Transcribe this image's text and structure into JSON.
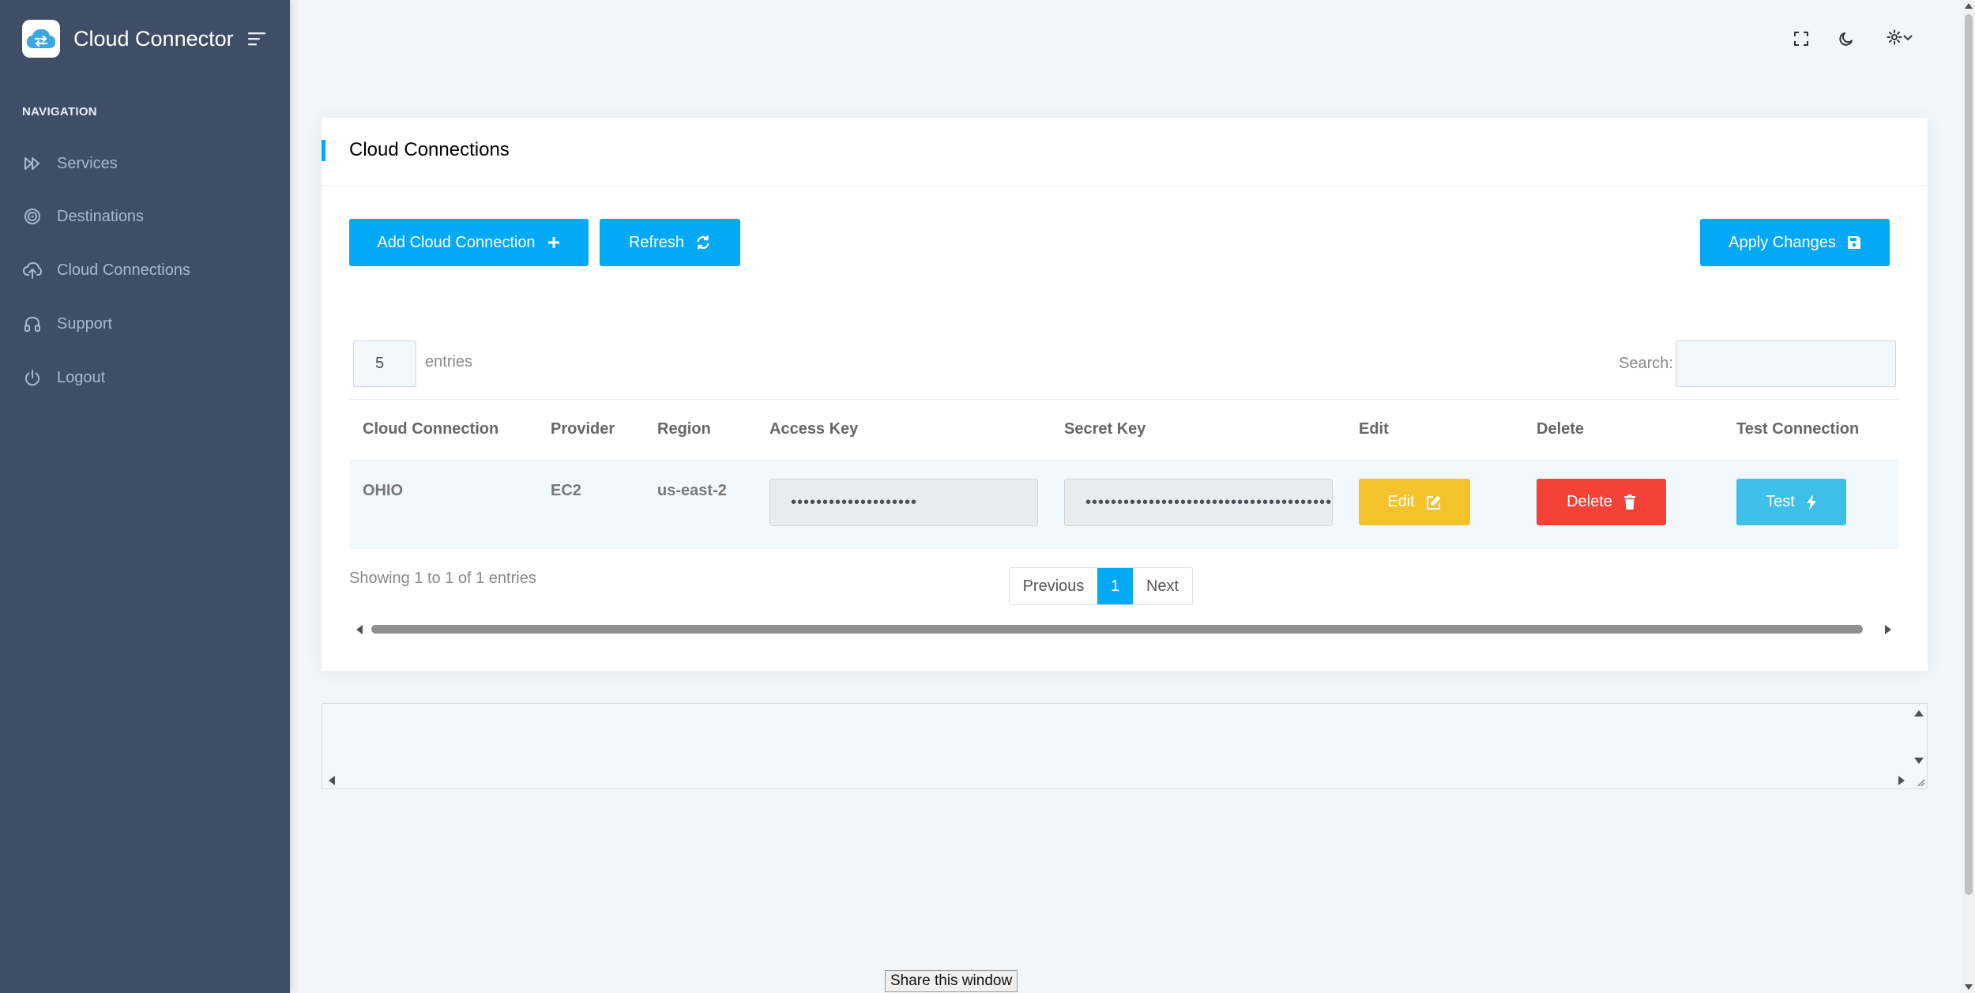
{
  "app": {
    "title": "Cloud Connector"
  },
  "sidebar": {
    "caption": "NAVIGATION",
    "items": [
      {
        "label": "Services",
        "icon": "fast-forward-icon"
      },
      {
        "label": "Destinations",
        "icon": "target-icon"
      },
      {
        "label": "Cloud Connections",
        "icon": "cloud-upload-icon"
      },
      {
        "label": "Support",
        "icon": "headphones-icon"
      },
      {
        "label": "Logout",
        "icon": "power-icon"
      }
    ]
  },
  "topbar": {
    "icons": [
      "fullscreen-icon",
      "moon-icon",
      "gear-icon",
      "chevron-down-icon"
    ]
  },
  "card": {
    "title": "Cloud Connections",
    "add_button": "Add Cloud Connection",
    "refresh_button": "Refresh",
    "apply_button": "Apply Changes"
  },
  "table": {
    "length_value": "5",
    "length_label": "entries",
    "search_label": "Search:",
    "search_value": "",
    "columns": [
      "Cloud Connection",
      "Provider",
      "Region",
      "Access Key",
      "Secret Key",
      "Edit",
      "Delete",
      "Test Connection"
    ],
    "rows": [
      {
        "cloud_connection": "OHIO",
        "provider": "EC2",
        "region": "us-east-2",
        "access_key": "••••••••••••••••••••",
        "secret_key": "••••••••••••••••••••••••••••••••••••••••",
        "edit_label": "Edit",
        "delete_label": "Delete",
        "test_label": "Test"
      }
    ],
    "info": "Showing 1 to 1 of 1 entries",
    "pager": {
      "previous": "Previous",
      "current": "1",
      "next": "Next"
    }
  },
  "tooltip": {
    "text": "Share this window"
  },
  "colors": {
    "sidebar": "#3f4d67",
    "primary": "#04a9f5",
    "warning": "#f4c22b",
    "danger": "#f44236",
    "info": "#3ebfea",
    "background": "#f2f6f9"
  }
}
